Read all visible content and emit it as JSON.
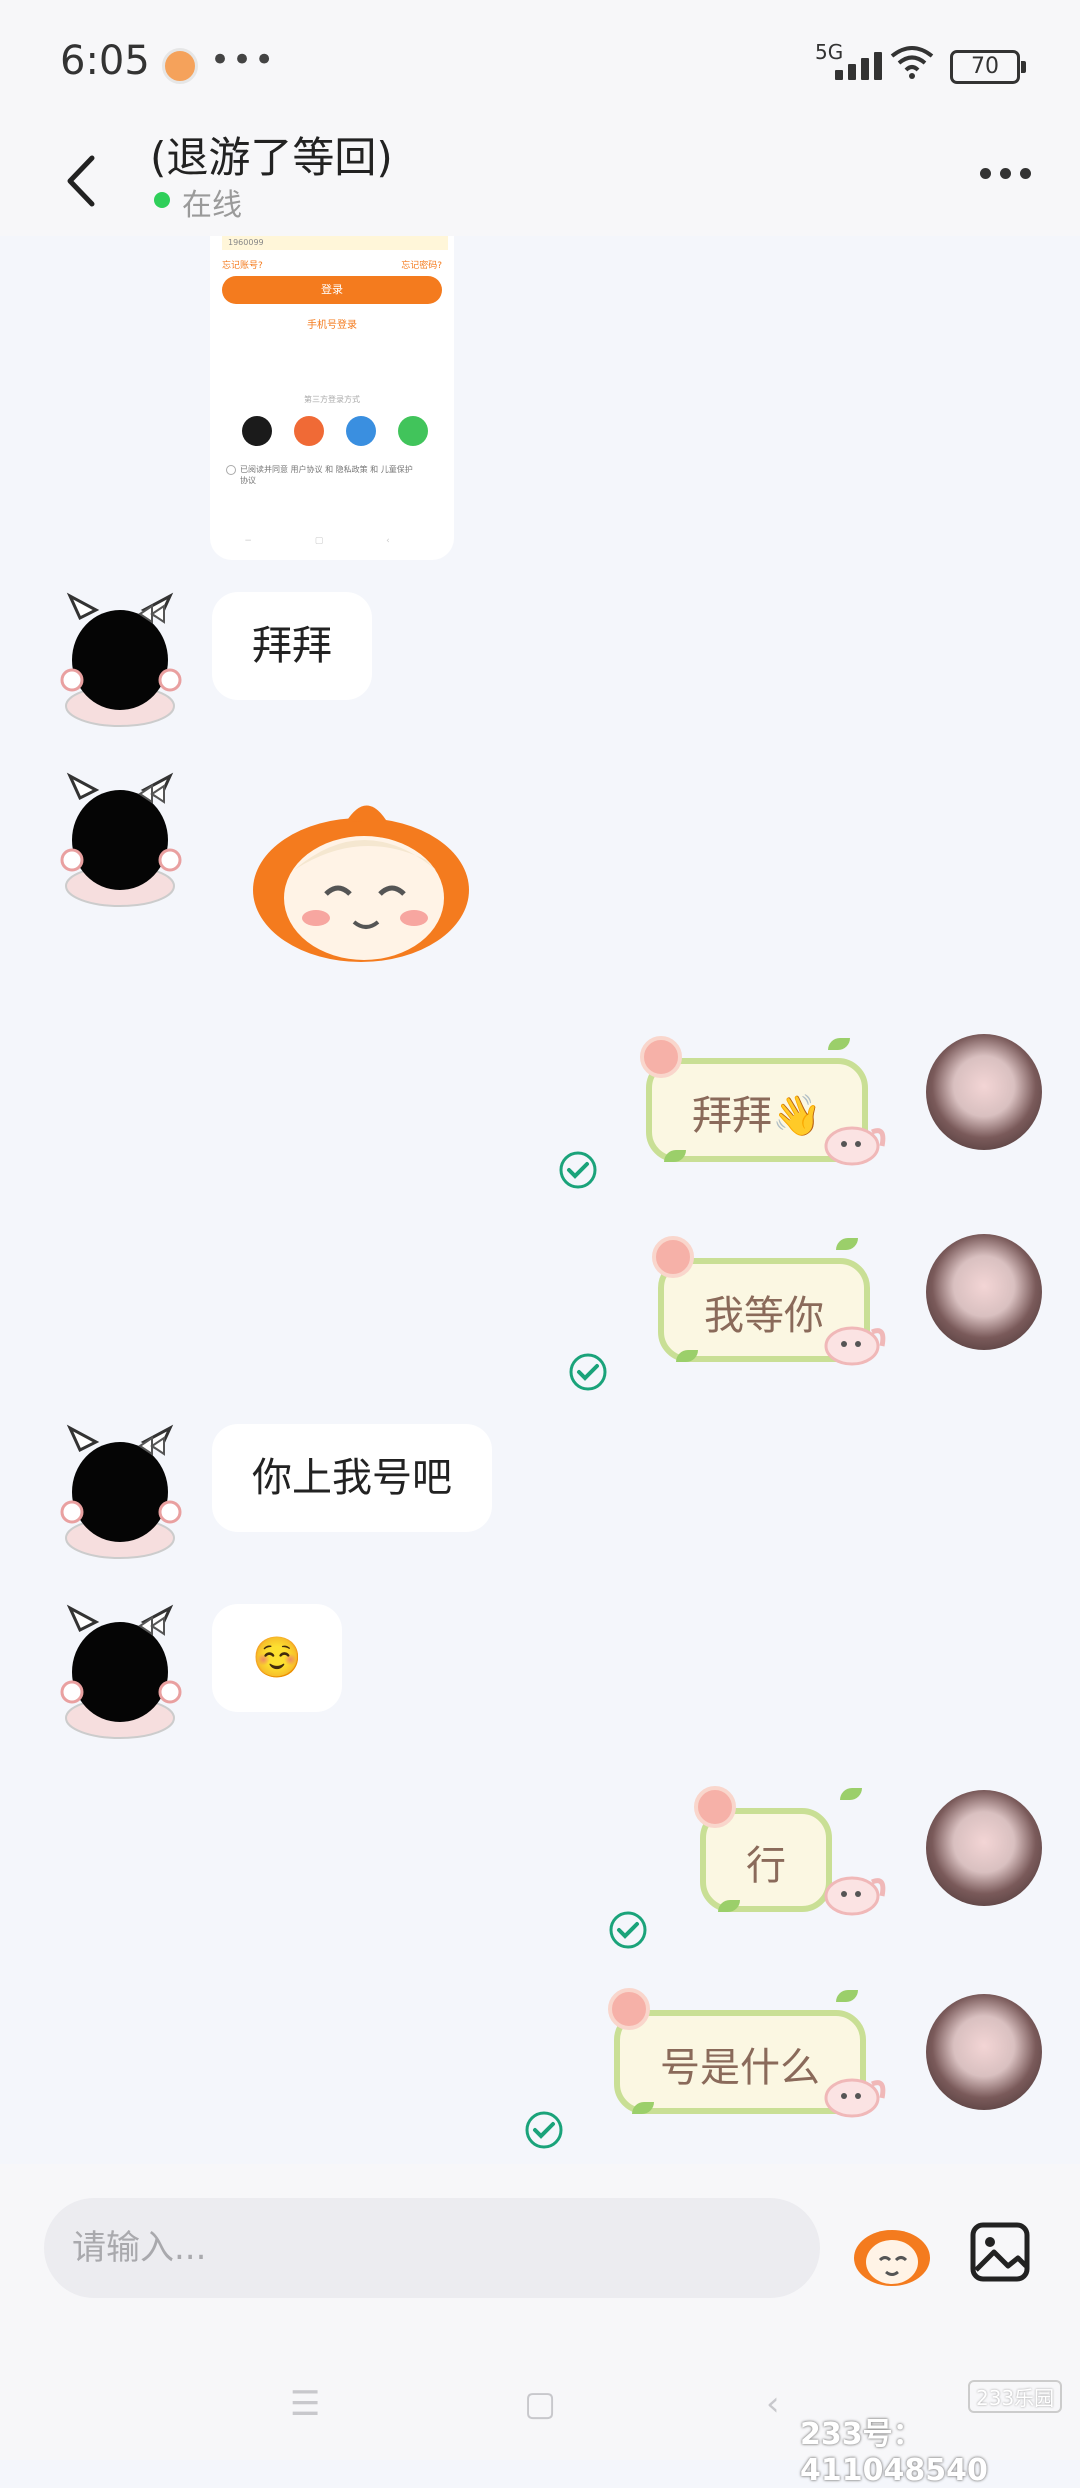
{
  "status_bar": {
    "time": "6:05",
    "network": "5G",
    "battery": "70"
  },
  "header": {
    "title": "(退游了等回)",
    "status": "在线"
  },
  "shared_screenshot": {
    "phone_field": "1960099",
    "forgot_account": "忘记账号?",
    "forgot_password": "忘记密码?",
    "login_button": "登录",
    "phone_login": "手机号登录",
    "third_party_label": "第三方登录方式",
    "agreement": "已阅读并同意 用户协议 和 隐私政策 和 儿童保护协议"
  },
  "messages": [
    {
      "side": "left",
      "type": "text",
      "text": "拜拜"
    },
    {
      "side": "left",
      "type": "sticker",
      "text": ""
    },
    {
      "side": "right",
      "type": "text",
      "text": "拜拜👋"
    },
    {
      "side": "right",
      "type": "text",
      "text": "我等你"
    },
    {
      "side": "left",
      "type": "text",
      "text": "你上我号吧"
    },
    {
      "side": "left",
      "type": "text",
      "text": "☺️"
    },
    {
      "side": "right",
      "type": "text",
      "text": "行"
    },
    {
      "side": "right",
      "type": "text",
      "text": "号是什么"
    }
  ],
  "input": {
    "placeholder": "请输入..."
  },
  "watermark": {
    "logo": "233乐园",
    "id": "233号：411048540"
  },
  "colors": {
    "accent_orange": "#f47b1e",
    "online_green": "#2fcf5a",
    "read_check": "#1aa37a",
    "bubble_border": "#c9df95"
  }
}
